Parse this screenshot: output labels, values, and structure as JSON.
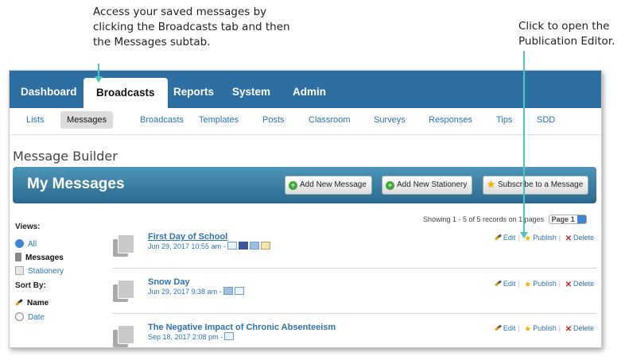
{
  "annotations": {
    "left": "Access your saved messages by clicking the Broadcasts tab and then the Messages subtab.",
    "right": "Click to open the Publication Editor."
  },
  "topnav": {
    "tabs": [
      "Dashboard",
      "Broadcasts",
      "Reports",
      "System",
      "Admin"
    ],
    "active": "Broadcasts"
  },
  "subnav": {
    "items": [
      "Lists",
      "Messages",
      "Broadcasts",
      "Templates",
      "Posts",
      "Classroom",
      "Surveys",
      "Responses",
      "Tips",
      "SDD"
    ],
    "active": "Messages"
  },
  "page_title": "Message Builder",
  "banner": {
    "title": "My Messages",
    "add_message": "Add New Message",
    "add_stationery": "Add New Stationery",
    "subscribe": "Subscribe to a Message"
  },
  "sidebar": {
    "views_label": "Views:",
    "views": [
      "All",
      "Messages",
      "Stationery"
    ],
    "active_view": "Messages",
    "sort_label": "Sort By:",
    "sort": [
      "Name",
      "Date"
    ],
    "active_sort": "Name"
  },
  "pagination": {
    "showing": "Showing 1 - 5 of 5 records on 1 pages",
    "page_select": "Page 1"
  },
  "actions": {
    "edit": "Edit",
    "publish": "Publish",
    "delete": "Delete"
  },
  "messages": [
    {
      "title": "First Day of School",
      "meta": "Jun 29, 2017 10:55 am -"
    },
    {
      "title": "Snow Day",
      "meta": "Jun 29, 2017 9:38 am -"
    },
    {
      "title": "The Negative Impact of Chronic Absenteeism",
      "meta": "Sep 18, 2017 2:08 pm -"
    }
  ],
  "colors": {
    "nav": "#2d6ea3",
    "banner": "#3a7fa3",
    "link": "#2a73b6",
    "annotation_arrow": "#4ec6c0"
  }
}
